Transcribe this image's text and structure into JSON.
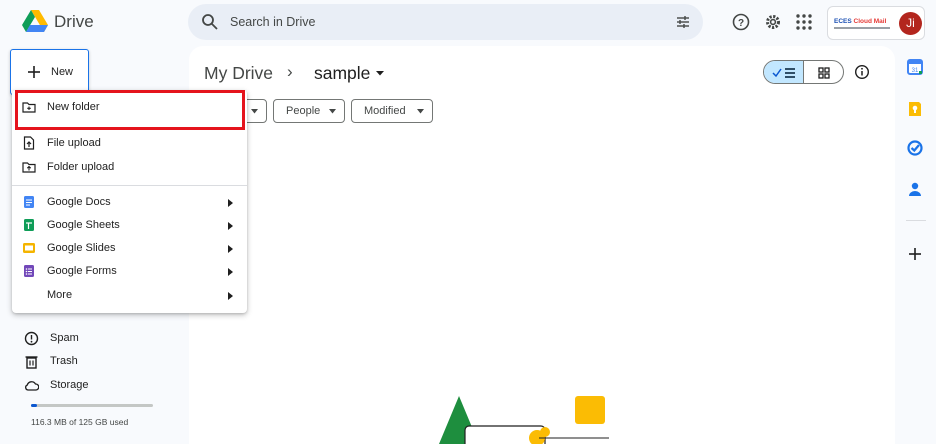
{
  "header": {
    "app_name": "Drive",
    "search_placeholder": "Search in Drive",
    "account_logo_main": "ECES ",
    "account_logo_accent": "Cloud Mail",
    "avatar_initials": "Ji"
  },
  "new_button": {
    "label": "New"
  },
  "menu": {
    "new_folder": "New folder",
    "file_upload": "File upload",
    "folder_upload": "Folder upload",
    "google_docs": "Google Docs",
    "google_sheets": "Google Sheets",
    "google_slides": "Google Slides",
    "google_forms": "Google Forms",
    "more": "More"
  },
  "sidebar": {
    "spam": "Spam",
    "trash": "Trash",
    "storage": "Storage",
    "storage_used_text": "116.3 MB of 125 GB used",
    "storage_used_fraction": 0.05
  },
  "breadcrumb": {
    "root": "My Drive",
    "separator": "›",
    "current": "sample"
  },
  "filters": {
    "people": "People",
    "modified": "Modified"
  },
  "colors": {
    "accent": "#0b57d0",
    "selected_toggle": "#c2e7ff",
    "highlight_border": "#e5141d",
    "avatar": "#b3261e",
    "docs": "#4285f4",
    "sheets": "#0f9d58",
    "slides": "#f4b400",
    "forms": "#7248b9"
  }
}
